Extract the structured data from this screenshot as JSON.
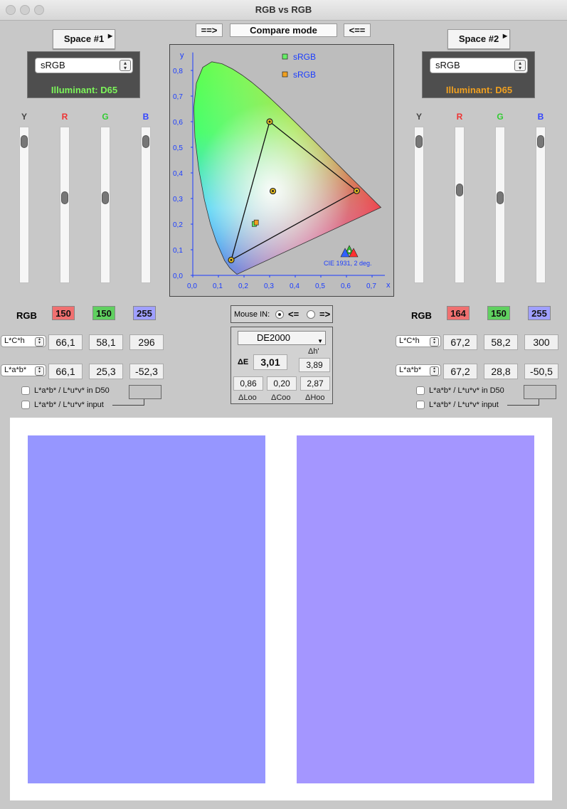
{
  "window": {
    "title": "RGB vs RGB"
  },
  "toolbar": {
    "left_arrow": "==>",
    "mode": "Compare mode",
    "right_arrow": "<=="
  },
  "left": {
    "space_button": "Space #1",
    "space_select": "sRGB",
    "illuminant": "Illuminant: D65",
    "illuminant_color": "#7cf55a",
    "sliders": [
      {
        "label": "Y",
        "color": "#444444",
        "level": 0.05
      },
      {
        "label": "R",
        "color": "#ee3333",
        "level": 0.41
      },
      {
        "label": "G",
        "color": "#33cc33",
        "level": 0.41
      },
      {
        "label": "B",
        "color": "#3344ff",
        "level": 0.05
      }
    ],
    "rgb_label": "RGB",
    "rgb": [
      "150",
      "150",
      "255"
    ],
    "lch_select": "L*C*h",
    "lch": [
      "66,1",
      "58,1",
      "296"
    ],
    "lab_select": "L*a*b*",
    "lab": [
      "66,1",
      "25,3",
      "-52,3"
    ],
    "check_d50": "L*a*b* / L*u*v* in D50",
    "check_input": "L*a*b* / L*u*v* input",
    "swatch_color": "#9696ff"
  },
  "right": {
    "space_button": "Space #2",
    "space_select": "sRGB",
    "illuminant": "Illuminant: D65",
    "illuminant_color": "#f0a020",
    "sliders": [
      {
        "label": "Y",
        "color": "#444444",
        "level": 0.05
      },
      {
        "label": "R",
        "color": "#ee3333",
        "level": 0.36
      },
      {
        "label": "G",
        "color": "#33cc33",
        "level": 0.41
      },
      {
        "label": "B",
        "color": "#3344ff",
        "level": 0.05
      }
    ],
    "rgb_label": "RGB",
    "rgb": [
      "164",
      "150",
      "255"
    ],
    "lch_select": "L*C*h",
    "lch": [
      "67,2",
      "58,2",
      "300"
    ],
    "lab_select": "L*a*b*",
    "lab": [
      "67,2",
      "28,8",
      "-50,5"
    ],
    "check_d50": "L*a*b* / L*u*v* in D50",
    "check_input": "L*a*b* / L*u*v* input",
    "swatch_color": "#a496ff"
  },
  "diagram": {
    "legend": [
      "sRGB",
      "sRGB"
    ],
    "legend_colors": [
      "#66ee66",
      "#f0a020"
    ],
    "x_axis": "x",
    "y_axis": "y",
    "x_ticks": [
      "0,0",
      "0,1",
      "0,2",
      "0,3",
      "0,4",
      "0,5",
      "0,6",
      "0,7"
    ],
    "y_ticks": [
      "0,0",
      "0,1",
      "0,2",
      "0,3",
      "0,4",
      "0,5",
      "0,6",
      "0,7",
      "0,8"
    ],
    "caption": "CIE 1931, 2 deg."
  },
  "mouse": {
    "label": "Mouse IN:",
    "left": "<=",
    "right": "=>"
  },
  "delta": {
    "formula": "DE2000",
    "de_label": "ΔE",
    "de_value": "3,01",
    "dh_label": "Δh'",
    "dh_value": "3,89",
    "dl_value": "0,86",
    "dc_value": "0,20",
    "dhh_value": "2,87",
    "dl_label": "ΔLoo",
    "dc_label": "ΔCoo",
    "dhh_label": "ΔHoo"
  }
}
